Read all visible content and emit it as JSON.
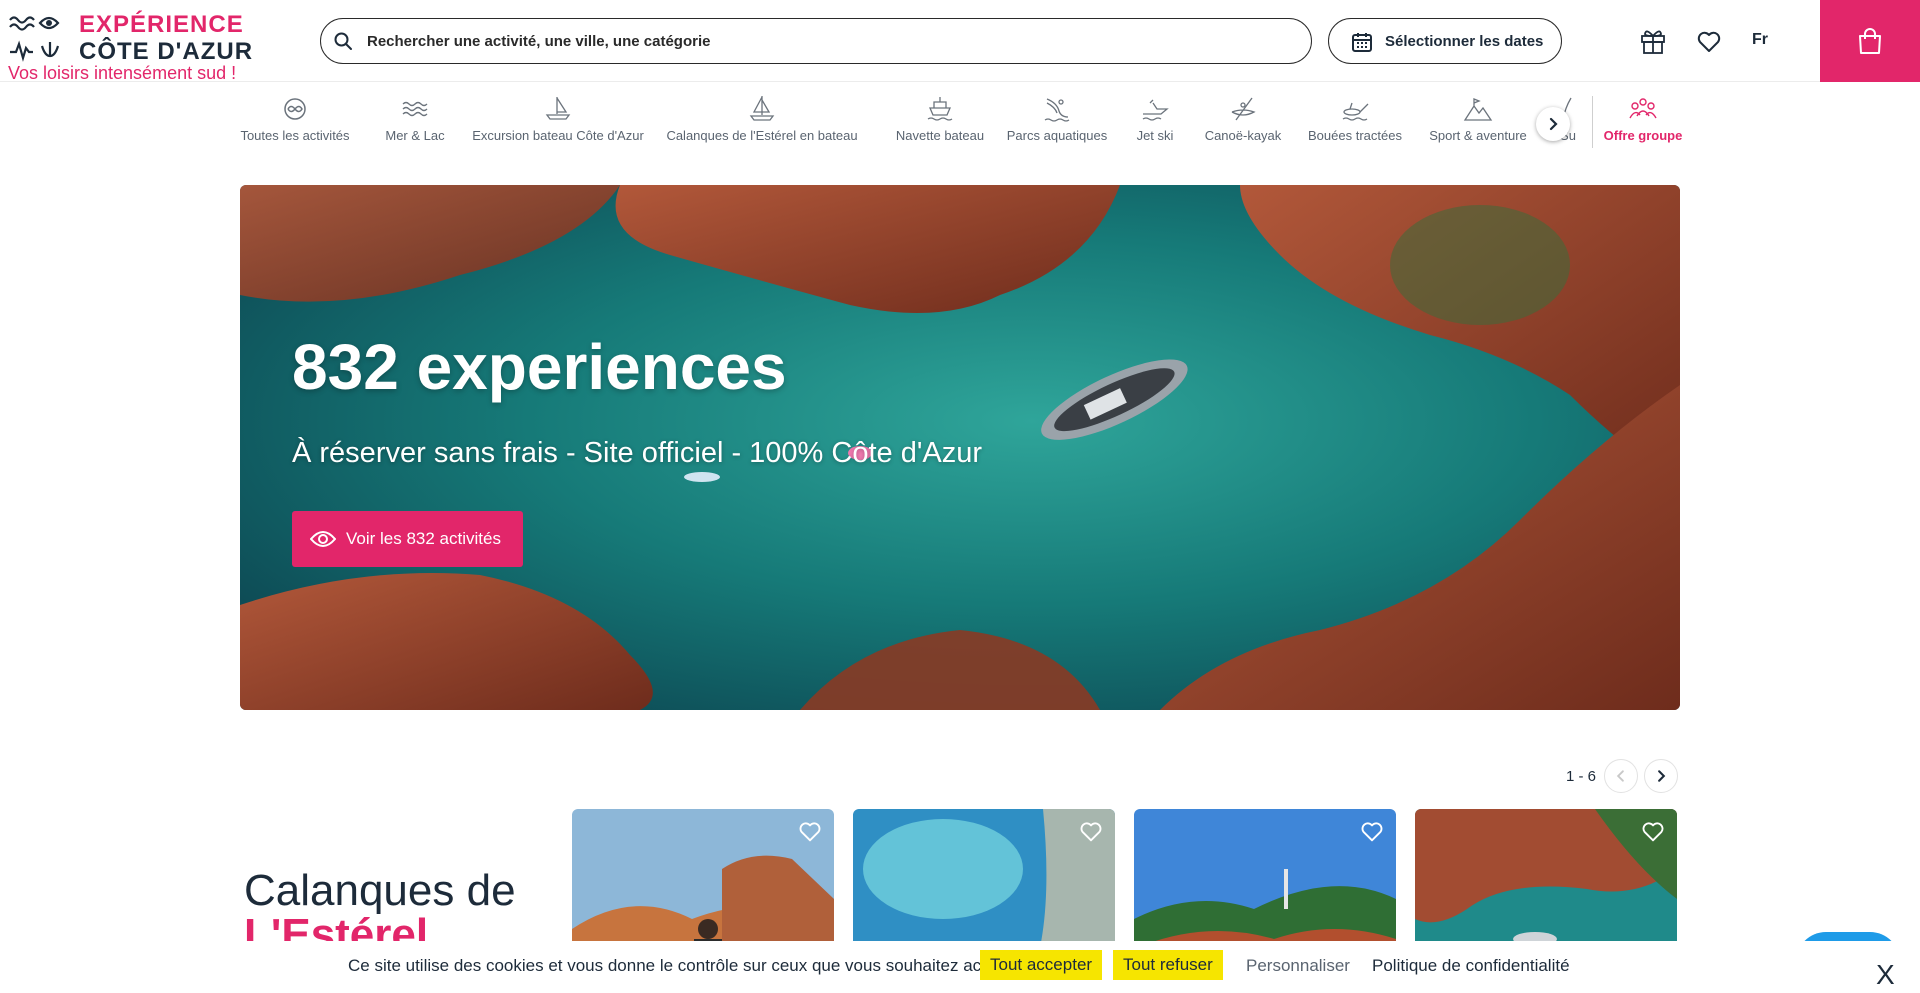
{
  "header": {
    "logo": {
      "line1": "EXPÉRIENCE",
      "line2": "CÔTE D'AZUR",
      "tagline": "Vos loisirs intensément sud !"
    },
    "search": {
      "placeholder": "Rechercher une activité, une ville, une catégorie",
      "value": ""
    },
    "dates_label": "Sélectionner les dates",
    "language": "Fr",
    "icons": [
      "gift-icon",
      "heart-icon",
      "shopping-bag-icon",
      "search-icon",
      "calendar-icon"
    ]
  },
  "categories": [
    {
      "label": "Toutes les activités",
      "icon": "infinity-icon"
    },
    {
      "label": "Mer & Lac",
      "icon": "waves-icon"
    },
    {
      "label": "Excursion bateau Côte d'Azur",
      "icon": "sailboat-icon"
    },
    {
      "label": "Calanques de l'Estérel en bateau",
      "icon": "sailboat-icon"
    },
    {
      "label": "Navette bateau",
      "icon": "ferry-icon"
    },
    {
      "label": "Parcs aquatiques",
      "icon": "water-slide-icon"
    },
    {
      "label": "Jet ski",
      "icon": "jet-ski-icon"
    },
    {
      "label": "Canoë-kayak",
      "icon": "kayak-icon"
    },
    {
      "label": "Bouées tractées",
      "icon": "tow-buoy-icon"
    },
    {
      "label": "Sport & aventure",
      "icon": "mountain-icon"
    },
    {
      "label": "Su",
      "icon": "surf-icon"
    }
  ],
  "group_offer": {
    "label": "Offre groupe",
    "icon": "group-icon"
  },
  "hero": {
    "title": "832 experiences",
    "subtitle": "À réserver sans frais - Site officiel - 100% Côte d'Azur",
    "button_label": "Voir les 832 activités"
  },
  "listing": {
    "pager": "1 - 6",
    "title_line1": "Calanques de",
    "title_line2": "L'Estérel",
    "cards": [
      {
        "icon": "heart-icon"
      },
      {
        "icon": "heart-icon"
      },
      {
        "icon": "heart-icon"
      },
      {
        "icon": "heart-icon"
      }
    ]
  },
  "cookie_bar": {
    "text": "Ce site utilise des cookies et vous donne le contrôle sur ceux que vous souhaitez activer",
    "accept": "Tout accepter",
    "refuse": "Tout refuser",
    "customize": "Personnaliser",
    "policy": "Politique de confidentialité",
    "close": "X"
  },
  "colors": {
    "brand_pink": "#e2266a",
    "navy": "#1d2b3a",
    "cookie_yellow": "#f6e500",
    "chat_blue": "#1e9be8"
  }
}
